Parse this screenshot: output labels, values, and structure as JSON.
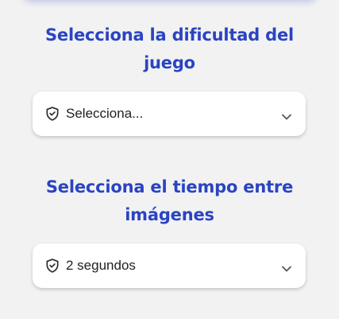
{
  "difficulty": {
    "title": "Selecciona la dificultad del juego",
    "select_value": "Selecciona...",
    "icon": "shield-check-icon"
  },
  "interval": {
    "title": "Selecciona el tiempo entre imágenes",
    "select_value": "2 segundos",
    "icon": "shield-check-icon"
  },
  "colors": {
    "title": "#2a44c2",
    "background": "#f2f2f2",
    "card": "#ffffff"
  }
}
